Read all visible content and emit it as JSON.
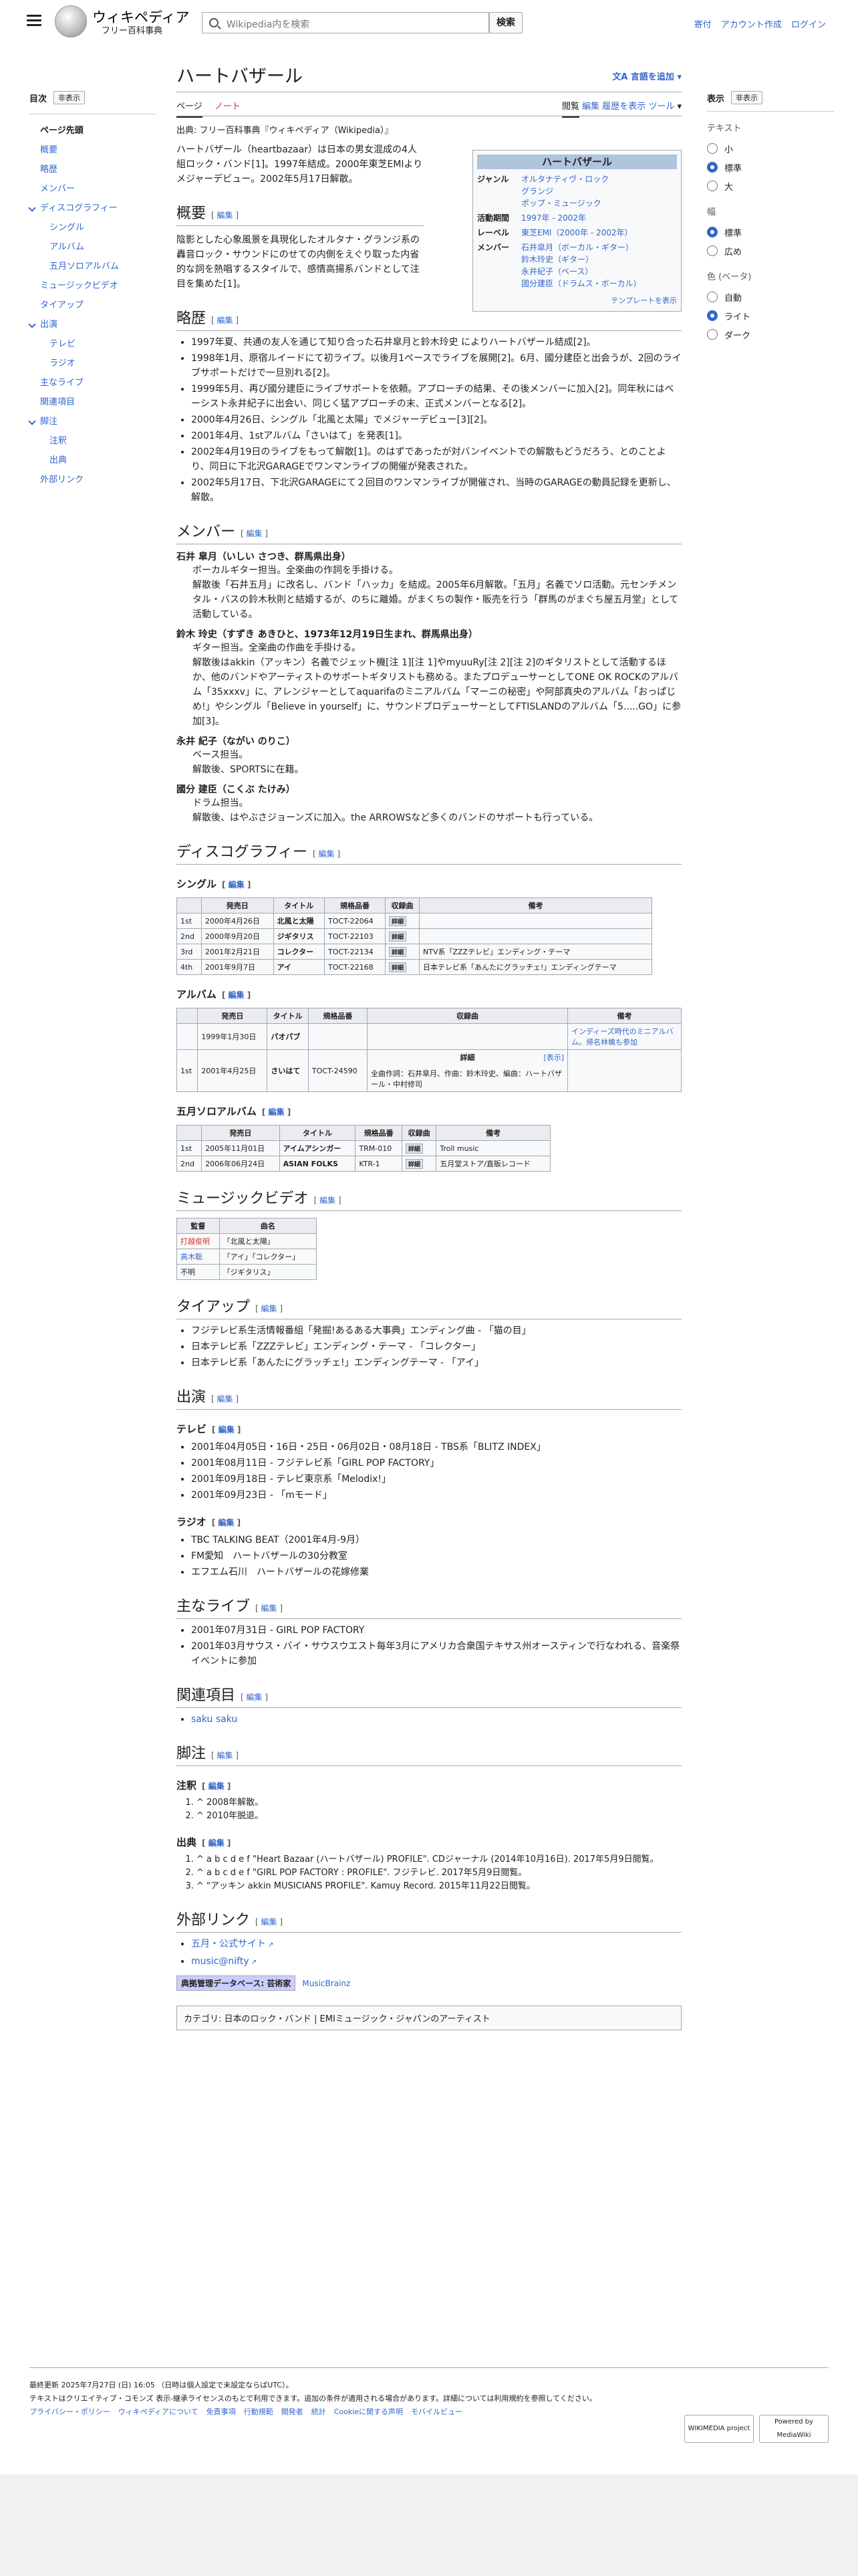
{
  "header": {
    "logo_title": "ウィキペディア",
    "logo_sub": "フリー百科事典",
    "search_placeholder": "Wikipedia内を検索",
    "search_button": "検索",
    "user_links": [
      "寄付",
      "アカウント作成",
      "ログイン"
    ]
  },
  "toc": {
    "title": "目次",
    "hide": "非表示",
    "items": [
      {
        "label": "ページ先頭",
        "level": 0,
        "top": true
      },
      {
        "label": "概要",
        "level": 0
      },
      {
        "label": "略歴",
        "level": 0
      },
      {
        "label": "メンバー",
        "level": 0
      },
      {
        "label": "ディスコグラフィー",
        "level": 0,
        "caret": true
      },
      {
        "label": "シングル",
        "level": 1
      },
      {
        "label": "アルバム",
        "level": 1
      },
      {
        "label": "五月ソロアルバム",
        "level": 1
      },
      {
        "label": "ミュージックビデオ",
        "level": 0
      },
      {
        "label": "タイアップ",
        "level": 0
      },
      {
        "label": "出演",
        "level": 0,
        "caret": true
      },
      {
        "label": "テレビ",
        "level": 1
      },
      {
        "label": "ラジオ",
        "level": 1
      },
      {
        "label": "主なライブ",
        "level": 0
      },
      {
        "label": "関連項目",
        "level": 0
      },
      {
        "label": "脚注",
        "level": 0,
        "caret": true
      },
      {
        "label": "注釈",
        "level": 1
      },
      {
        "label": "出典",
        "level": 1
      },
      {
        "label": "外部リンク",
        "level": 0
      }
    ]
  },
  "appearance": {
    "title": "表示",
    "hide": "非表示",
    "text_label": "テキスト",
    "text_options": [
      "小",
      "標準",
      "大"
    ],
    "width_label": "幅",
    "width_options": [
      "標準",
      "広め"
    ],
    "color_label": "色 (ベータ)",
    "color_options": [
      "自動",
      "ライト",
      "ダーク"
    ]
  },
  "page": {
    "title": "ハートバザール",
    "lang_button": "言語を追加",
    "tabs_left": [
      "ページ",
      "ノート"
    ],
    "tabs_right": [
      "閲覧",
      "編集",
      "履歴を表示",
      "ツール"
    ],
    "from": "出典: フリー百科事典『ウィキペディア（Wikipedia）』",
    "edit_label": "編集",
    "intro": "ハートバザール（heartbazaar）は日本の男女混成の4人組ロック・バンド[1]。1997年結成。2000年東芝EMIよりメジャーデビュー。2002年5月17日解散。",
    "overview_title": "概要",
    "overview_text": "陰影とした心象風景を具現化したオルタナ・グランジ系の轟音ロック・サウンドにのせての内側をえぐり取った内省的な詞を熱唱するスタイルで、感情高揚系バンドとして注目を集めた[1]。",
    "history_title": "略歴",
    "history": [
      "1997年夏、共通の友人を通じて知り合った石井皐月と鈴木玲史 によりハートバザール結成[2]。",
      "1998年1月、原宿ルイードにて初ライブ。以後月1ペースでライブを展開[2]。6月、國分建臣と出会うが、2回のライブサポートだけで一旦別れる[2]。",
      "1999年5月、再び國分建臣にライブサポートを依頼。アプローチの結果、その後メンバーに加入[2]。同年秋にはベーシスト永井紀子に出会い、同じく猛アプローチの末、正式メンバーとなる[2]。",
      "2000年4月26日、シングル「北風と太陽」でメジャーデビュー[3][2]。",
      "2001年4月、1stアルバム「さいはて」を発表[1]。",
      "2002年4月19日のライブをもって解散[1]。のはずであったが対バンイベントでの解散もどうだろう、とのことより、同日に下北沢GARAGEでワンマンライブの開催が発表された。",
      "2002年5月17日、下北沢GARAGEにて２回目のワンマンライブが開催され、当時のGARAGEの動員記録を更新し、解散。"
    ],
    "members_title": "メンバー",
    "members": [
      {
        "name": "石井 皐月（いしい さつき、群馬県出身）",
        "lines": [
          "ボーカルギター担当。全楽曲の作詞を手掛ける。",
          "解散後「石井五月」に改名し、バンド「ハッカ」を結成。2005年6月解散。「五月」名義でソロ活動。元センチメンタル・バスの鈴木秋則と結婚するが、のちに離婚。がまくちの製作・販売を行う「群馬のがまぐち屋五月堂」として活動している。"
        ]
      },
      {
        "name": "鈴木 玲史（すずき あきひと、1973年12月19日生まれ、群馬県出身）",
        "lines": [
          "ギター担当。全楽曲の作曲を手掛ける。",
          "解散後はakkin（アッキン）名義でジェット機[注 1][注 1]やmyuuRy[注 2][注 2]のギタリストとして活動するほか、他のバンドやアーティストのサポートギタリストも務める。またプロデューサーとしてONE OK ROCKのアルバム「35xxxv」に、アレンジャーとしてaquarifaのミニアルバム「マーニの秘密」や阿部真央のアルバム「おっぱじめ!」やシングル「Believe in yourself」に、サウンドプロデューサーとしてFTISLANDのアルバム「5.....GO」に参加[3]。"
        ]
      },
      {
        "name": "永井 紀子（ながい のりこ）",
        "lines": [
          "ベース担当。",
          "解散後、SPORTSに在籍。"
        ]
      },
      {
        "name": "國分 建臣（こくぶ たけみ）",
        "lines": [
          "ドラム担当。",
          "解散後、はやぶさジョーンズに加入。the ARROWSなど多くのバンドのサポートも行っている。"
        ]
      }
    ],
    "discography_title": "ディスコグラフィー",
    "singles_title": "シングル",
    "singles_headers": [
      "",
      "発売日",
      "タイトル",
      "規格品番",
      "収録曲",
      "備考"
    ],
    "singles": [
      [
        "1st",
        "2000年4月26日",
        "北風と太陽",
        "TOCT-22064",
        "詳細",
        ""
      ],
      [
        "2nd",
        "2000年9月20日",
        "ジギタリス",
        "TOCT-22103",
        "詳細",
        ""
      ],
      [
        "3rd",
        "2001年2月21日",
        "コレクター",
        "TOCT-22134",
        "詳細",
        "NTV系「ZZZテレビ」エンディング・テーマ"
      ],
      [
        "4th",
        "2001年9月7日",
        "アイ",
        "TOCT-22168",
        "詳細",
        "日本テレビ系「あんたにグラッチェ!」エンディングテーマ"
      ]
    ],
    "albums_title": "アルバム",
    "albums_headers": [
      "",
      "発売日",
      "タイトル",
      "規格品番",
      "収録曲",
      "備考"
    ],
    "albums": [
      {
        "num": "",
        "date": "1999年1月30日",
        "title": "パオパブ",
        "code": "",
        "tracks_title": "",
        "tracks": "",
        "note": "インディーズ時代のミニアルバム。帰名林檎も参加"
      },
      {
        "num": "1st",
        "date": "2001年4月25日",
        "title": "さいはて",
        "code": "TOCT-24590",
        "tracks_title": "詳細",
        "tracks": "全曲作詞：石井皐月、作曲：鈴木玲史、編曲：ハートバザール・中村修司",
        "note": ""
      }
    ],
    "show_label": "[表示]",
    "solo_title": "五月ソロアルバム",
    "solo_headers": [
      "",
      "発売日",
      "タイトル",
      "規格品番",
      "収録曲",
      "備考"
    ],
    "solo": [
      [
        "1st",
        "2005年11月01日",
        "アイムアシンガー",
        "TRM-010",
        "詳細",
        "Troll music"
      ],
      [
        "2nd",
        "2006年06月24日",
        "ASIAN FOLKS",
        "KTR-1",
        "詳細",
        "五月堂ストア/直販レコード"
      ]
    ],
    "mv_title": "ミュージックビデオ",
    "mv_headers": [
      "監督",
      "曲名"
    ],
    "mv": [
      [
        "打越俊明",
        "「北風と太陽」"
      ],
      [
        "高木聡",
        "「アイ」「コレクター」"
      ],
      [
        "不明",
        "「ジギタリス」"
      ]
    ],
    "tieup_title": "タイアップ",
    "tieups": [
      "フジテレビ系生活情報番組「発掘!あるある大事典」エンディング曲 - 「猫の目」",
      "日本テレビ系「ZZZテレビ」エンディング・テーマ - 「コレクター」",
      "日本テレビ系「あんたにグラッチェ!」エンディングテーマ - 「アイ」"
    ],
    "appear_title": "出演",
    "tv_title": "テレビ",
    "tv": [
      "2001年04月05日・16日・25日・06月02日・08月18日 - TBS系「BLITZ INDEX」",
      "2001年08月11日 - フジテレビ系「GIRL POP FACTORY」",
      "2001年09月18日 - テレビ東京系「Melodix!」",
      "2001年09月23日 - 「mモード」"
    ],
    "radio_title": "ラジオ",
    "radio": [
      "TBC TALKING BEAT（2001年4月-9月）",
      "FM愛知　ハートバザールの30分教室",
      "エフエム石川　ハートバザールの花嫁修業"
    ],
    "live_title": "主なライブ",
    "lives": [
      "2001年07月31日 - GIRL POP FACTORY",
      "2001年03月サウス・バイ・サウスウエスト毎年3月にアメリカ合衆国テキサス州オースティンで行なわれる、音楽祭イベントに参加"
    ],
    "related_title": "関連項目",
    "related": [
      "saku saku"
    ],
    "notes_title": "脚注",
    "annot_title": "注釈",
    "annots": [
      "^ 2008年解散。",
      "^ 2010年脱退。"
    ],
    "sources_title": "出典",
    "sources": [
      "^ a b c d e f \"Heart Bazaar (ハートバザール) PROFILE\". CDジャーナル (2014年10月16日). 2017年5月9日閲覧。",
      "^ a b c d e f \"GIRL POP FACTORY : PROFILE\". フジテレビ. 2017年5月9日閲覧。",
      "^ \"アッキン akkin MUSICIANS PROFILE\". Kamuy Record. 2015年11月22日閲覧。"
    ],
    "ext_title": "外部リンク",
    "ext": [
      "五月・公式サイト",
      "music@nifty"
    ],
    "authority_label": "典拠管理データベース: 芸術家",
    "authority_link": "MusicBrainz",
    "categories": "カテゴリ: 日本のロック・バンド | EMIミュージック・ジャパンのアーティスト"
  },
  "infobox": {
    "title": "ハートバザール",
    "rows": [
      {
        "k": "ジャンル",
        "v": "オルタナティヴ・ロック\nグランジ\nポップ・ミュージック"
      },
      {
        "k": "活動期間",
        "v": "1997年 - 2002年"
      },
      {
        "k": "レーベル",
        "v": "東芝EMI（2000年 - 2002年）"
      },
      {
        "k": "メンバー",
        "v": "石井皐月（ボーカル・ギター）\n鈴木玲史（ギター）\n永井紀子（ベース）\n國分建臣（ドラムス・ボーカル）"
      }
    ],
    "footer": "テンプレートを表示"
  },
  "footer": {
    "updated": "最終更新 2025年7月27日 (日) 16:05 （日時は個人設定で未設定ならばUTC）。",
    "license": "テキストはクリエイティブ・コモンズ 表示-継承ライセンスのもとで利用できます。追加の条件が適用される場合があります。詳細については利用規約を参照してください。",
    "links": [
      "プライバシー・ポリシー",
      "ウィキペディアについて",
      "免責事項",
      "行動規範",
      "開発者",
      "統計",
      "Cookieに関する声明",
      "モバイルビュー"
    ],
    "badges": [
      "WIKIMEDIA project",
      "Powered by MediaWiki"
    ]
  }
}
